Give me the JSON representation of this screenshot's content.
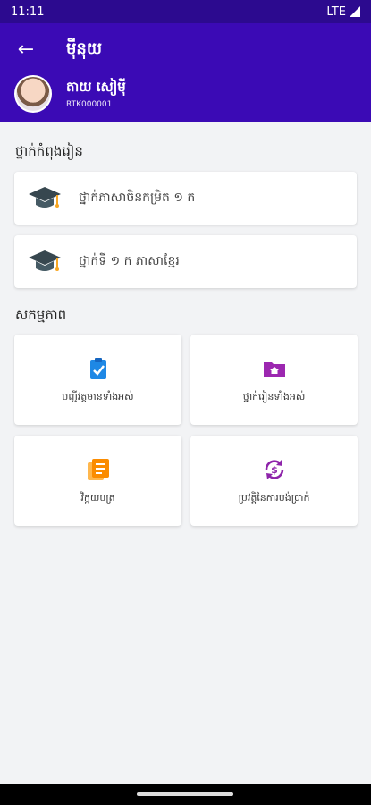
{
  "status": {
    "time": "11:11",
    "network": "LTE"
  },
  "header": {
    "title": "ម៉ឺនុយ",
    "user_name": "តាយ សៀម៉ី",
    "user_id": "RTK000001"
  },
  "sections": {
    "classes_title": "ថ្នាក់កំពុងរៀន",
    "services_title": "សកម្មភាព"
  },
  "classes": [
    {
      "label": "ថ្នាក់ភាសាចិនកម្រិត ១ ក"
    },
    {
      "label": "ថ្នាក់ទី ១ ក ភាសាខ្មែរ"
    }
  ],
  "services": [
    {
      "label": "បញ្ជីវត្តមានទាំងអស់",
      "icon": "clipboard-check-icon",
      "color": "#1e88e5"
    },
    {
      "label": "ថ្នាក់រៀនទាំងអស់",
      "icon": "folder-home-icon",
      "color": "#9c27b0"
    },
    {
      "label": "វិក្កយបត្រ",
      "icon": "document-list-icon",
      "color": "#fb8c00"
    },
    {
      "label": "ប្រវត្តិនៃការបង់ប្រាក់",
      "icon": "payment-history-icon",
      "color": "#8e24aa"
    }
  ]
}
